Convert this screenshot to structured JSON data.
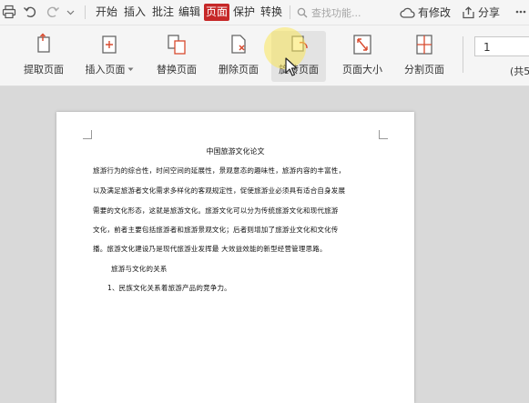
{
  "menubar": {
    "tabs": [
      "开始",
      "插入",
      "批注",
      "编辑",
      "页面",
      "保护",
      "转换"
    ],
    "active_tab": "页面",
    "search_placeholder": "查找功能...",
    "has_changes": "有修改",
    "share": "分享"
  },
  "ribbon": {
    "extract_pages": "提取页面",
    "insert_pages": "插入页面",
    "replace_pages": "替换页面",
    "delete_pages": "删除页面",
    "rotate_pages": "旋转页面",
    "page_size": "页面大小",
    "split_pages": "分割页面",
    "page_number": "1",
    "page_total": "(共5"
  },
  "document": {
    "title": "中国旅游文化论文",
    "lines": [
      "旅游行为的综合性，时间空间的延展性，景观意态的趣味性，旅游内容的丰富性，",
      "以及满足旅游者文化需求多样化的客观规定性，促使旅游业必须具有适合自身发展",
      "需要的文化形态，这就是旅游文化。旅游文化可以分为传统旅游文化和现代旅游",
      "文化，前者主要包括旅游者和旅游景观文化；后者则增加了旅游业文化和文化传",
      "播。旅游文化建设乃是现代旅游业发挥最  大效益效能的新型经营管理思路。",
      "旅游与文化的关系",
      "1、民族文化关系着旅游产品的竞争力。"
    ]
  },
  "colors": {
    "accent": "#c62828",
    "highlight": "#f5e14f"
  },
  "icons": [
    "print-icon",
    "undo-icon",
    "redo-icon",
    "search-icon",
    "cloud-icon",
    "share-icon"
  ]
}
